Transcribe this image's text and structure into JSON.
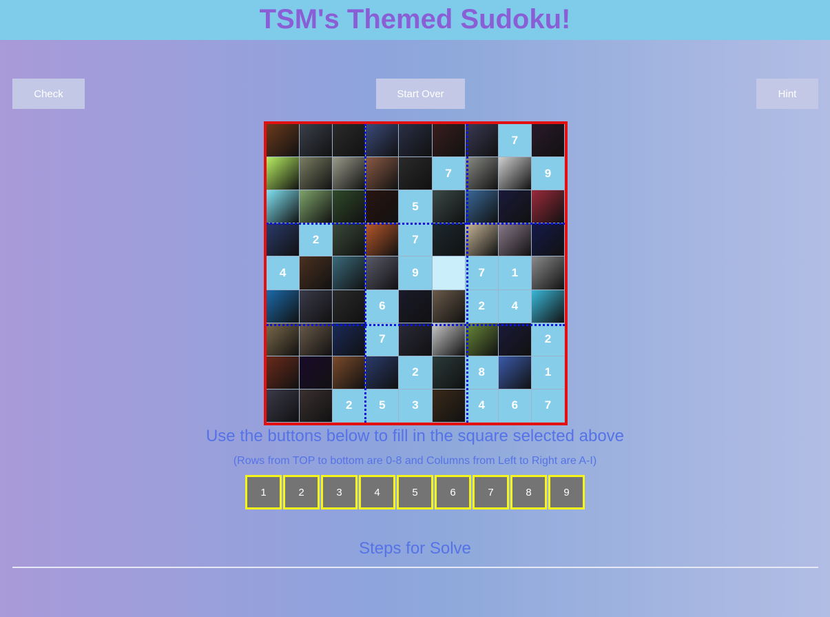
{
  "header": {
    "title": "TSM's Themed Sudoku!"
  },
  "controls": {
    "check_label": "Check",
    "start_over_label": "Start Over",
    "hint_label": "Hint"
  },
  "board": {
    "rows": [
      [
        "img",
        "img",
        "img",
        "img",
        "img",
        "img",
        "img",
        "7",
        "img"
      ],
      [
        "img",
        "img",
        "img",
        "img",
        "img",
        "7",
        "img",
        "img",
        "9"
      ],
      [
        "img",
        "img",
        "img",
        "img",
        "5",
        "img",
        "img",
        "img",
        "img"
      ],
      [
        "img",
        "2",
        "img",
        "img",
        "7",
        "img",
        "img",
        "img",
        "img"
      ],
      [
        "4",
        "img",
        "img",
        "img",
        "9",
        "",
        "7",
        "1",
        "img"
      ],
      [
        "img",
        "img",
        "img",
        "6",
        "img",
        "img",
        "2",
        "4",
        "img"
      ],
      [
        "img",
        "img",
        "img",
        "7",
        "img",
        "img",
        "img",
        "img",
        "2"
      ],
      [
        "img",
        "img",
        "img",
        "img",
        "2",
        "img",
        "8",
        "img",
        "1"
      ],
      [
        "img",
        "img",
        "2",
        "5",
        "3",
        "img",
        "4",
        "6",
        "7"
      ]
    ],
    "image_colors": [
      [
        "#6b3a1c",
        "#3a3f4a",
        "#2b2b2b",
        "#3c4a7a",
        "#2a2f45",
        "#3a1e1e",
        "#3a3a55",
        "",
        "#2a1a2a"
      ],
      [
        "#b8f062",
        "#7a7d62",
        "#9a9a8a",
        "#8a5a45",
        "#2a2a2a",
        "",
        "#8a8c86",
        "#cfcfcf",
        ""
      ],
      [
        "#7fe3f2",
        "#7ea46a",
        "#2f4a2a",
        "#2a1510",
        "",
        "#3a4a48",
        "#3a6a9a",
        "#1a1a3a",
        "#9a2a3a"
      ],
      [
        "#2a3a6a",
        "",
        "#3a4a3a",
        "#b8582a",
        "",
        "#1c2a30",
        "#c9b89a",
        "#8a7a8a",
        "#141a4a"
      ],
      [
        "",
        "#4a3020",
        "#3a6a7a",
        "#5a5a6a",
        "",
        "",
        "",
        "",
        "#8a8a8a"
      ],
      [
        "#1a6aaa",
        "#3a3a4a",
        "#2a2a2a",
        "",
        "#1a1a2a",
        "#6a5a4a",
        "",
        "",
        "#3ab8d8"
      ],
      [
        "#7a6a4a",
        "#6a5a4a",
        "#1a2a5a",
        "",
        "#2a2a3a",
        "#c8c8c8",
        "#6a8a3a",
        "#1a1a3a",
        ""
      ],
      [
        "#6a2a1a",
        "#1a0a2a",
        "#7a4a2a",
        "#2a3a6a",
        "",
        "#2a3a3a",
        "",
        "#3a5aaa",
        ""
      ],
      [
        "#3a3a4a",
        "#3a3030",
        "",
        "",
        "",
        "#3a2a1a",
        "",
        "",
        ""
      ]
    ]
  },
  "instructions": {
    "main": "Use the buttons below to fill in the square selected above",
    "sub": "(Rows from TOP to bottom are 0-8 and Columns from Left to Right are A-I)"
  },
  "numpad": {
    "digits": [
      "1",
      "2",
      "3",
      "4",
      "5",
      "6",
      "7",
      "8",
      "9"
    ]
  },
  "steps": {
    "title": "Steps for Solve"
  },
  "colors": {
    "title_bar": "#7fcbea",
    "title_text": "#8a5fd6",
    "board_border": "#e21010",
    "box_divider": "#0a14e0",
    "number_cell": "#86cdea",
    "numpad_border": "#f5f51a",
    "numpad_bg": "#747474",
    "accent_text": "#5573e6"
  }
}
